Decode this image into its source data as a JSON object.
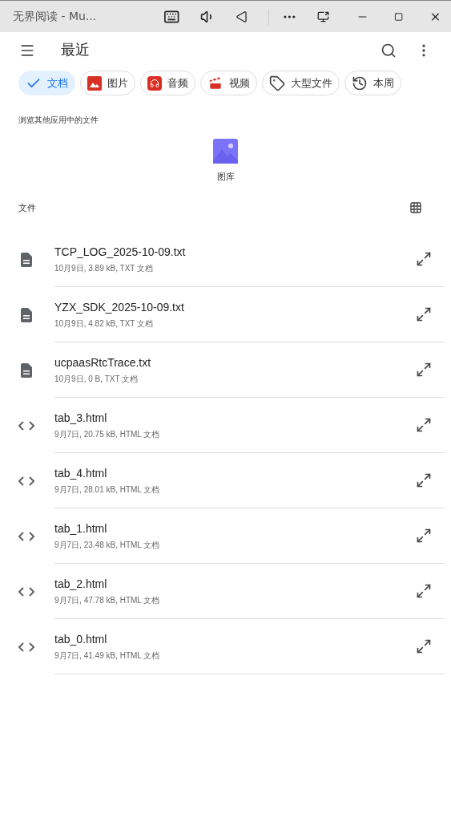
{
  "window": {
    "title": "无界阅读 - Mu..."
  },
  "app_bar": {
    "title": "最近"
  },
  "chips": [
    {
      "kind": "document",
      "label": "文档",
      "selected": true
    },
    {
      "kind": "image",
      "label": "图片",
      "selected": false
    },
    {
      "kind": "audio",
      "label": "音频",
      "selected": false
    },
    {
      "kind": "video",
      "label": "视频",
      "selected": false
    },
    {
      "kind": "large",
      "label": "大型文件",
      "selected": false
    },
    {
      "kind": "week",
      "label": "本周",
      "selected": false
    }
  ],
  "other_apps": {
    "heading": "浏览其他应用中的文件",
    "apps": [
      {
        "label": "图库"
      }
    ]
  },
  "files": {
    "heading": "文件",
    "items": [
      {
        "kind": "txt",
        "name": "TCP_LOG_2025-10-09.txt",
        "meta": "10月9日, 3.89 kB, TXT 文档"
      },
      {
        "kind": "txt",
        "name": "YZX_SDK_2025-10-09.txt",
        "meta": "10月9日, 4.82 kB, TXT 文档"
      },
      {
        "kind": "txt",
        "name": "ucpaasRtcTrace.txt",
        "meta": "10月9日, 0 B, TXT 文档"
      },
      {
        "kind": "html",
        "name": "tab_3.html",
        "meta": "9月7日, 20.75 kB, HTML 文档"
      },
      {
        "kind": "html",
        "name": "tab_4.html",
        "meta": "9月7日, 28.01 kB, HTML 文档"
      },
      {
        "kind": "html",
        "name": "tab_1.html",
        "meta": "9月7日, 23.48 kB, HTML 文档"
      },
      {
        "kind": "html",
        "name": "tab_2.html",
        "meta": "9月7日, 47.78 kB, HTML 文档"
      },
      {
        "kind": "html",
        "name": "tab_0.html",
        "meta": "9月7日, 41.49 kB, HTML 文档"
      }
    ]
  }
}
